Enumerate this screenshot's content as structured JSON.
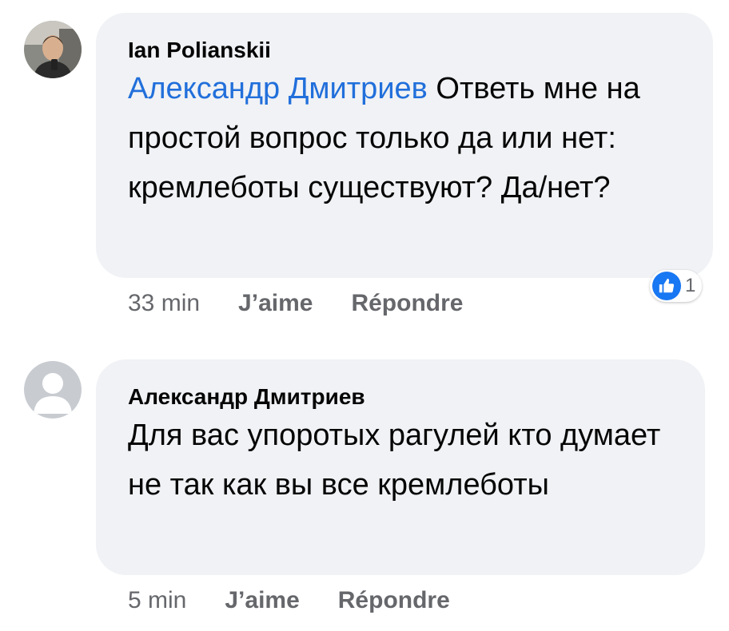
{
  "comments": [
    {
      "author": "Ian Polianskii",
      "mention": "Александр Дмитриев",
      "text": " Ответь мне на простой вопрос только да или нет: кремлеботы существуют? Да/нет?",
      "time": "33 min",
      "like_label": "J’aime",
      "reply_label": "Répondre",
      "reaction_count": "1",
      "reaction_icon": "like-icon",
      "avatar": "profile-photo"
    },
    {
      "author": "Александр Дмитриев",
      "text": "Для вас упоротых рагулей кто думает не так как вы все кремлеботы",
      "time": "5 min",
      "like_label": "J’aime",
      "reply_label": "Répondre",
      "avatar": "default-avatar-icon"
    }
  ],
  "colors": {
    "bubble": "#f0f2f5",
    "mention": "#216fdb",
    "meta": "#65676b",
    "like_badge": "#1877f2"
  }
}
